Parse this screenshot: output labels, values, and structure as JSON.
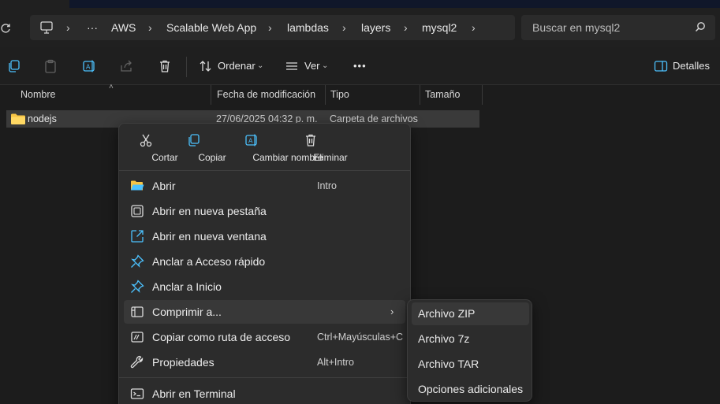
{
  "address_bar": {
    "overflow": "···",
    "crumbs": [
      "AWS",
      "Scalable Web App",
      "lambdas",
      "layers",
      "mysql2"
    ],
    "search_placeholder": "Buscar en mysql2"
  },
  "toolbar": {
    "sort_label": "Ordenar",
    "view_label": "Ver",
    "more_label": "•••",
    "details_label": "Detalles"
  },
  "columns": {
    "name": "Nombre",
    "modified": "Fecha de modificación",
    "type": "Tipo",
    "size": "Tamaño"
  },
  "files": [
    {
      "name": "nodejs",
      "modified": "27/06/2025 04:32 p. m.",
      "type": "Carpeta de archivos",
      "size": ""
    }
  ],
  "context_menu": {
    "quick_actions": [
      {
        "label": "Cortar",
        "icon": "scissors-icon"
      },
      {
        "label": "Copiar",
        "icon": "copy-icon"
      },
      {
        "label": "Cambiar nombre",
        "icon": "rename-icon"
      },
      {
        "label": "Eliminar",
        "icon": "trash-icon"
      }
    ],
    "items": [
      {
        "label": "Abrir",
        "shortcut": "Intro",
        "icon": "folder-open-icon"
      },
      {
        "label": "Abrir en nueva pestaña",
        "shortcut": "",
        "icon": "new-tab-icon"
      },
      {
        "label": "Abrir en nueva ventana",
        "shortcut": "",
        "icon": "new-window-icon"
      },
      {
        "label": "Anclar a Acceso rápido",
        "shortcut": "",
        "icon": "pin-icon"
      },
      {
        "label": "Anclar a Inicio",
        "shortcut": "",
        "icon": "pin-icon"
      },
      {
        "label": "Comprimir a...",
        "shortcut": "",
        "icon": "compress-icon",
        "arrow": "›"
      },
      {
        "label": "Copiar como ruta de acceso",
        "shortcut": "Ctrl+Mayúsculas+C",
        "icon": "path-icon"
      },
      {
        "label": "Propiedades",
        "shortcut": "Alt+Intro",
        "icon": "wrench-icon"
      },
      {
        "label": "Abrir en Terminal",
        "shortcut": "",
        "icon": "terminal-icon"
      }
    ]
  },
  "submenu": {
    "items": [
      "Archivo ZIP",
      "Archivo 7z",
      "Archivo TAR",
      "Opciones adicionales"
    ]
  },
  "colors": {
    "accent": "#4cc2ff",
    "folder": "#f6c445",
    "menu_bg": "#2c2c2c",
    "selection": "#3a3a3a"
  }
}
